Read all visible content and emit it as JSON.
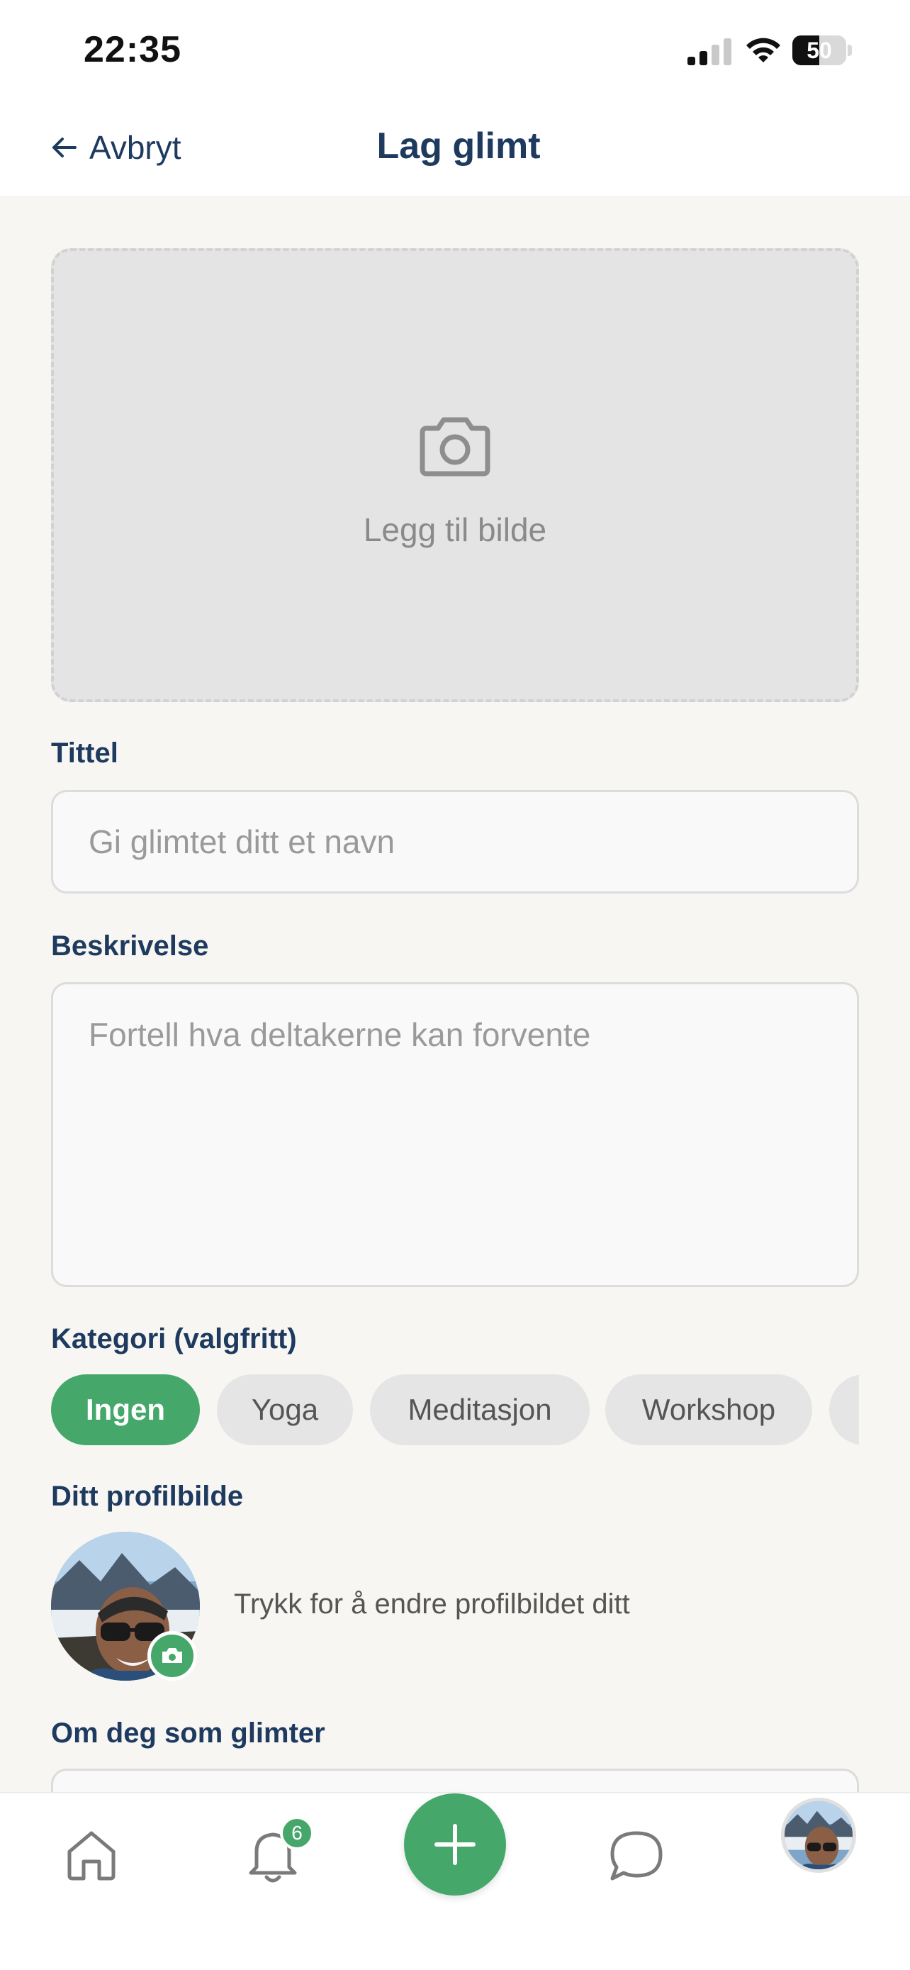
{
  "status_bar": {
    "time": "22:35",
    "battery_percent": 50,
    "battery_text": "50"
  },
  "header": {
    "back_label": "Avbryt",
    "title": "Lag glimt"
  },
  "image_picker": {
    "label": "Legg til bilde",
    "icon": "camera-icon"
  },
  "form": {
    "title_label": "Tittel",
    "title_placeholder": "Gi glimtet ditt et navn",
    "description_label": "Beskrivelse",
    "description_placeholder": "Fortell hva deltakerne kan forvente",
    "category_label": "Kategori (valgfritt)",
    "categories": [
      "Ingen",
      "Yoga",
      "Meditasjon",
      "Workshop"
    ],
    "selected_category": "Ingen",
    "profile_label": "Ditt profilbilde",
    "profile_hint": "Trykk for å endre profilbildet ditt",
    "about_label": "Om deg som glimter"
  },
  "bottom_nav": {
    "items": [
      "home-icon",
      "bell-icon",
      "plus-icon",
      "chat-icon",
      "avatar"
    ],
    "notification_count": "6"
  },
  "colors": {
    "accent": "#45a86a",
    "navy": "#1e3a5f",
    "background": "#f7f6f3"
  }
}
